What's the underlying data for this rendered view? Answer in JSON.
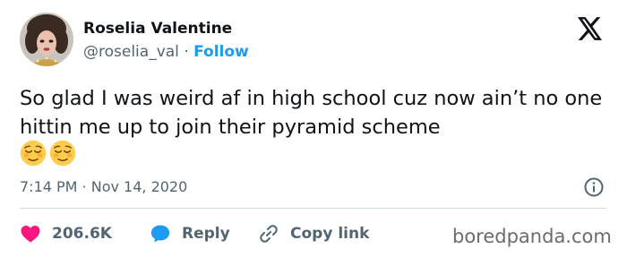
{
  "author": {
    "name": "Roselia Valentine",
    "handle": "@roselia_val",
    "separator": "·",
    "follow_label": "Follow"
  },
  "tweet": {
    "text": "So glad I was weird af in high school cuz now ain’t no one hittin me up to join their pyramid scheme",
    "emojis": [
      "relieved-face-emoji",
      "relieved-face-emoji"
    ],
    "timestamp": "7:14 PM · Nov 14, 2020"
  },
  "actions": {
    "like_count": "206.6K",
    "reply_label": "Reply",
    "copy_label": "Copy link"
  },
  "icons": {
    "platform": "x-logo-icon",
    "info": "info-icon",
    "like": "heart-icon",
    "reply": "speech-bubble-icon",
    "copy": "link-icon"
  },
  "colors": {
    "accent": "#1d9bf0",
    "like": "#f91880",
    "text": "#0f1419",
    "muted": "#536471"
  },
  "watermark": "boredpanda.com"
}
